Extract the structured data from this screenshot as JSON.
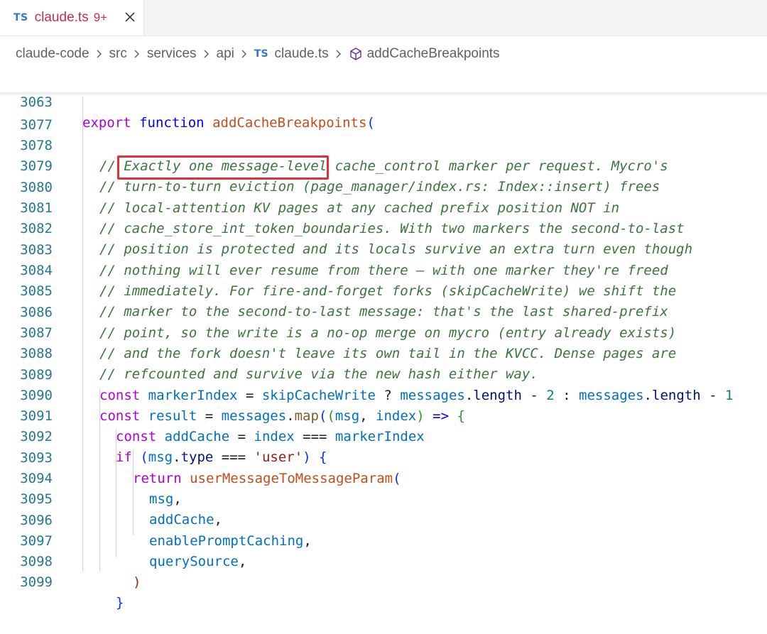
{
  "tab": {
    "badge": "TS",
    "file_name": "claude.ts",
    "problem_count": "9+",
    "close_icon": "close-icon"
  },
  "breadcrumbs": {
    "items": [
      "claude-code",
      "src",
      "services",
      "api"
    ],
    "file_badge": "TS",
    "file": "claude.ts",
    "symbol_icon": "method-cube-icon",
    "symbol": "addCacheBreakpoints"
  },
  "sticky_line": {
    "number": "3063",
    "keyword_export": "export",
    "keyword_function": "function",
    "name": "addCacheBreakpoints",
    "paren": "("
  },
  "lines": [
    {
      "n": "3077",
      "text": ""
    },
    {
      "n": "3078",
      "text": "// Exactly one message-level cache_control marker per request. Mycro's"
    },
    {
      "n": "3079",
      "text": "// turn-to-turn eviction (page_manager/index.rs: Index::insert) frees"
    },
    {
      "n": "3080",
      "text": "// local-attention KV pages at any cached prefix position NOT in"
    },
    {
      "n": "3081",
      "text": "// cache_store_int_token_boundaries. With two markers the second-to-last"
    },
    {
      "n": "3082",
      "text": "// position is protected and its locals survive an extra turn even though"
    },
    {
      "n": "3083",
      "text": "// nothing will ever resume from there — with one marker they're freed"
    },
    {
      "n": "3084",
      "text": "// immediately. For fire-and-forget forks (skipCacheWrite) we shift the"
    },
    {
      "n": "3085",
      "text": "// marker to the second-to-last message: that's the last shared-prefix"
    },
    {
      "n": "3086",
      "text": "// point, so the write is a no-op merge on mycro (entry already exists)"
    },
    {
      "n": "3087",
      "text": "// and the fork doesn't leave its own tail in the KVCC. Dense pages are"
    },
    {
      "n": "3088",
      "text": "// refcounted and survive via the new hash either way."
    },
    {
      "n": "3089",
      "text": "const markerIndex = skipCacheWrite ? messages.length - 2 : messages.length - 1"
    },
    {
      "n": "3090",
      "text": "const result = messages.map((msg, index) => {"
    },
    {
      "n": "3091",
      "text": "const addCache = index === markerIndex"
    },
    {
      "n": "3092",
      "text": "if (msg.type === 'user') {"
    },
    {
      "n": "3093",
      "text": "return userMessageToMessageParam("
    },
    {
      "n": "3094",
      "text": "msg,"
    },
    {
      "n": "3095",
      "text": "addCache,"
    },
    {
      "n": "3096",
      "text": "enablePromptCaching,"
    },
    {
      "n": "3097",
      "text": "querySource,"
    },
    {
      "n": "3098",
      "text": ")"
    },
    {
      "n": "3099",
      "text": "}"
    }
  ],
  "highlight": {
    "text": "local-attention KV pages",
    "color": "#e0313a"
  }
}
